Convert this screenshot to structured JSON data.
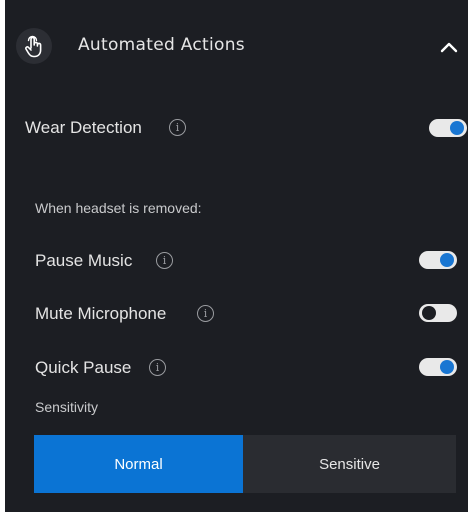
{
  "header": {
    "title": "Automated Actions",
    "icon": "touch-hand-icon",
    "collapse_icon": "chevron-up-icon",
    "expanded": true
  },
  "wear_detection": {
    "label": "Wear Detection",
    "info_glyph": "i",
    "enabled": true
  },
  "removed_section": {
    "caption": "When headset is removed:",
    "items": [
      {
        "label": "Pause Music",
        "info_glyph": "i",
        "enabled": true
      },
      {
        "label": "Mute Microphone",
        "info_glyph": "i",
        "enabled": false
      },
      {
        "label": "Quick Pause",
        "info_glyph": "i",
        "enabled": true
      }
    ]
  },
  "sensitivity": {
    "label": "Sensitivity",
    "options": [
      "Normal",
      "Sensitive"
    ],
    "selected": "Normal"
  },
  "colors": {
    "panel_bg": "#1c1e23",
    "accent": "#0b74d4",
    "toggle_knob_on": "#1976d2",
    "segment_inactive": "#2a2c31"
  }
}
